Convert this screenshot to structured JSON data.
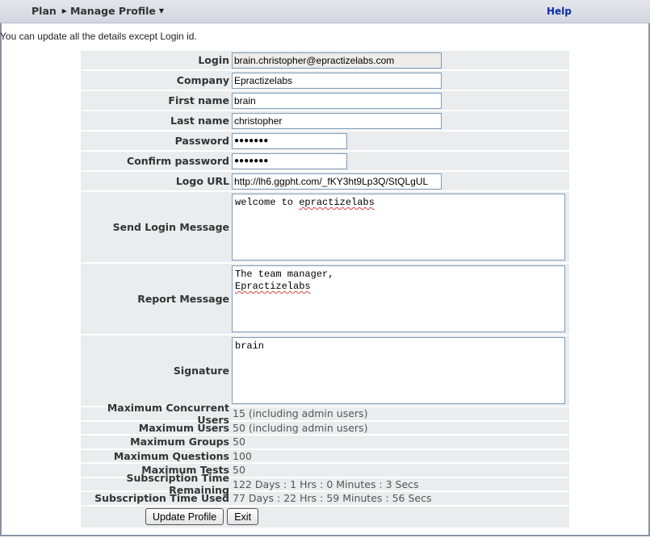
{
  "header": {
    "crumb_plan": "Plan",
    "crumb_page": "Manage Profile",
    "help": "Help"
  },
  "intro": "You can update all the details except Login id.",
  "fields": {
    "login": {
      "label": "Login",
      "value": "brain.christopher@epractizelabs.com"
    },
    "company": {
      "label": "Company",
      "value": "Epractizelabs"
    },
    "first_name": {
      "label": "First name",
      "value": "brain"
    },
    "last_name": {
      "label": "Last name",
      "value": "christopher"
    },
    "password": {
      "label": "Password",
      "value": "●●●●●●●"
    },
    "confirm_password": {
      "label": "Confirm password",
      "value": "●●●●●●●"
    },
    "logo_url": {
      "label": "Logo URL",
      "value": "http://lh6.ggpht.com/_fKY3ht9Lp3Q/StQLgUL"
    },
    "send_login_message": {
      "label": "Send Login Message",
      "line1_a": "welcome to ",
      "line1_b": "epractizelabs"
    },
    "report_message": {
      "label": "Report Message",
      "line1": "The team manager,",
      "line2": "Epractizelabs"
    },
    "signature": {
      "label": "Signature",
      "line1": "brain"
    }
  },
  "info": [
    {
      "label": "Maximum Concurrent Users",
      "value": "15 (including admin users)"
    },
    {
      "label": "Maximum Users",
      "value": "50 (including admin users)"
    },
    {
      "label": "Maximum Groups",
      "value": "50"
    },
    {
      "label": "Maximum Questions",
      "value": "100"
    },
    {
      "label": "Maximum Tests",
      "value": "50"
    },
    {
      "label": "Subscription Time Remaining",
      "value": "122 Days : 1 Hrs : 0 Minutes : 3 Secs"
    },
    {
      "label": "Subscription Time Used",
      "value": "77 Days : 22 Hrs : 59 Minutes : 56 Secs"
    }
  ],
  "buttons": {
    "update": "Update Profile",
    "exit": "Exit"
  }
}
